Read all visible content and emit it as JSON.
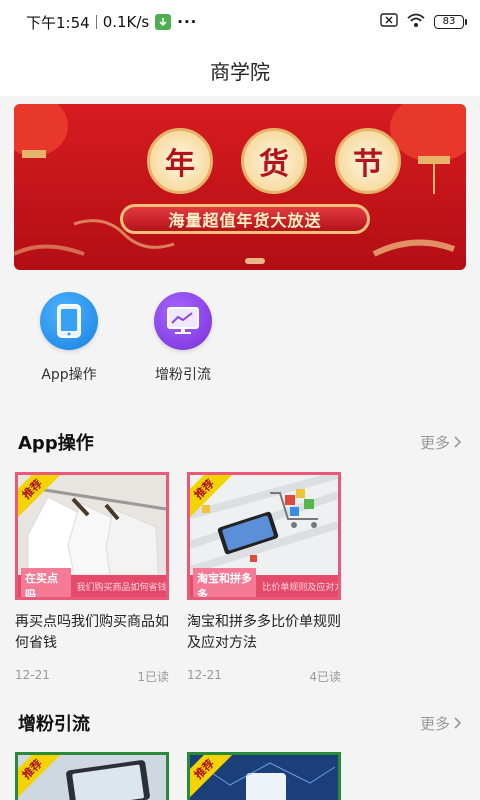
{
  "status_bar": {
    "time": "下午1:54",
    "speed": "0.1K/s",
    "more": "···",
    "battery": "83"
  },
  "header": {
    "title": "商学院"
  },
  "banner": {
    "chars": [
      "年",
      "货",
      "节"
    ],
    "subtitle": "海量超值年货大放送",
    "colors": {
      "background": "#c8151b",
      "gold": "#f1c17a"
    }
  },
  "quick_entries": [
    {
      "label": "App操作",
      "icon": "phone-icon",
      "color": "#1f8fe8"
    },
    {
      "label": "增粉引流",
      "icon": "monitor-icon",
      "color": "#8a3ee0"
    }
  ],
  "sections": [
    {
      "title": "App操作",
      "more": "更多",
      "cards": [
        {
          "tag": "推荐",
          "thumb_label": "在买点吗",
          "thumb_sub": "我们购买商品如何省钱?",
          "title": "再买点吗我们购买商品如何省钱",
          "date": "12-21",
          "reads": "1已读"
        },
        {
          "tag": "推荐",
          "thumb_label": "淘宝和拼多多",
          "thumb_sub": "比价单规则及应对方法",
          "title": "淘宝和拼多多比价单规则及应对方法",
          "date": "12-21",
          "reads": "4已读"
        }
      ]
    },
    {
      "title": "增粉引流",
      "more": "更多",
      "cards": [
        {
          "tag": "推荐"
        },
        {
          "tag": "推荐"
        }
      ]
    }
  ]
}
